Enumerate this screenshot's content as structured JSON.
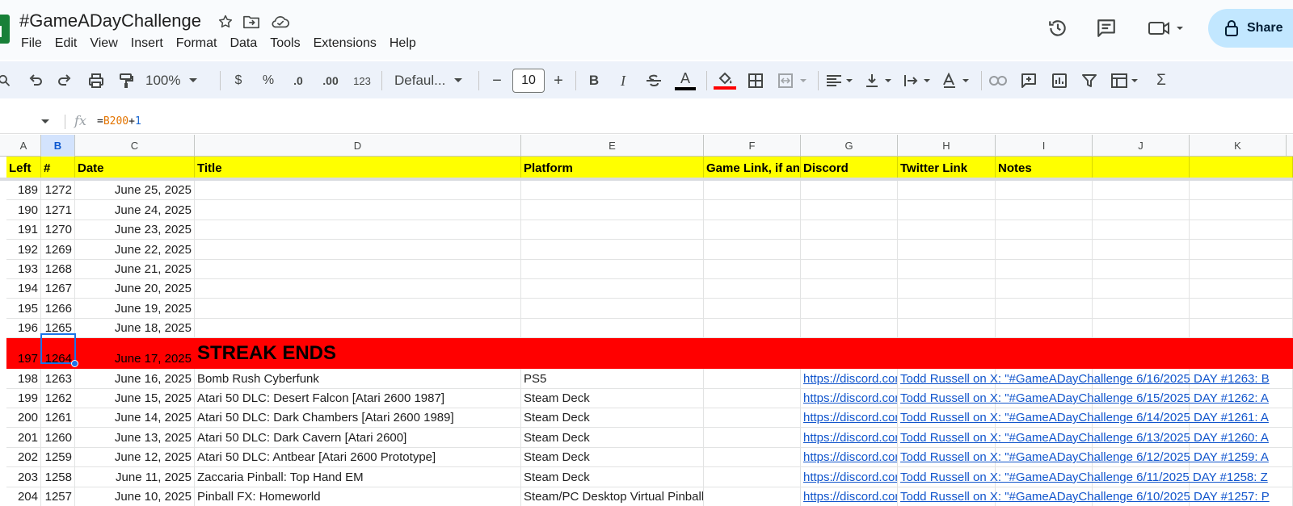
{
  "doc": {
    "title": "#GameADayChallenge",
    "star_icon": "star-icon",
    "move_icon": "folder-move-icon",
    "cloud_icon": "cloud-status-icon"
  },
  "menu": [
    "File",
    "Edit",
    "View",
    "Insert",
    "Format",
    "Data",
    "Tools",
    "Extensions",
    "Help"
  ],
  "top_right": {
    "history_icon": "history-icon",
    "comments_icon": "comment-icon",
    "meet_icon": "video-call-icon",
    "share_label": "Share"
  },
  "toolbar": {
    "zoom": "100%",
    "currency": "$",
    "percent": "%",
    "decrease_decimal": ".0",
    "increase_decimal": ".00",
    "more_formats": "123",
    "font": "Defaul...",
    "font_size": "10",
    "minus": "−",
    "plus": "+",
    "bold": "B",
    "italic": "I",
    "text_color_label": "A",
    "text_color": "#000000",
    "fill_color": "#ff0000",
    "sum": "Σ"
  },
  "formula_bar": {
    "name_box": "",
    "fx": "fx",
    "eq": "=",
    "ref": "B200",
    "op": "+",
    "num": "1"
  },
  "columns": [
    "A",
    "B",
    "C",
    "D",
    "E",
    "F",
    "G",
    "H",
    "I",
    "J",
    "K"
  ],
  "selected_column": "B",
  "header": {
    "left": "Left",
    "num": "#",
    "date": "Date",
    "title": "Title",
    "platform": "Platform",
    "game_link": "Game Link, if any",
    "discord": "Discord",
    "twitter": "Twitter Link",
    "notes": "Notes"
  },
  "rows": [
    {
      "left": "189",
      "num": "1272",
      "date": "June 25, 2025",
      "title": "",
      "platform": "",
      "discord": "",
      "twitter": ""
    },
    {
      "left": "190",
      "num": "1271",
      "date": "June 24, 2025",
      "title": "",
      "platform": "",
      "discord": "",
      "twitter": ""
    },
    {
      "left": "191",
      "num": "1270",
      "date": "June 23, 2025",
      "title": "",
      "platform": "",
      "discord": "",
      "twitter": ""
    },
    {
      "left": "192",
      "num": "1269",
      "date": "June 22, 2025",
      "title": "",
      "platform": "",
      "discord": "",
      "twitter": ""
    },
    {
      "left": "193",
      "num": "1268",
      "date": "June 21, 2025",
      "title": "",
      "platform": "",
      "discord": "",
      "twitter": ""
    },
    {
      "left": "194",
      "num": "1267",
      "date": "June 20, 2025",
      "title": "",
      "platform": "",
      "discord": "",
      "twitter": ""
    },
    {
      "left": "195",
      "num": "1266",
      "date": "June 19, 2025",
      "title": "",
      "platform": "",
      "discord": "",
      "twitter": ""
    },
    {
      "left": "196",
      "num": "1265",
      "date": "June 18, 2025",
      "title": "",
      "platform": "",
      "discord": "",
      "twitter": ""
    }
  ],
  "streak_row": {
    "left": "197",
    "num": "1264",
    "date": "June 17, 2025",
    "title": "STREAK ENDS"
  },
  "rows_after": [
    {
      "left": "198",
      "num": "1263",
      "date": "June 16, 2025",
      "title": "Bomb Rush Cyberfunk",
      "platform": "PS5",
      "discord": "https://discord.com",
      "twitter": "Todd Russell on X: \"#GameADayChallenge 6/16/2025 DAY #1263: B"
    },
    {
      "left": "199",
      "num": "1262",
      "date": "June 15, 2025",
      "title": "Atari 50 DLC: Desert Falcon [Atari 2600 1987]",
      "platform": "Steam Deck",
      "discord": "https://discord.com",
      "twitter": "Todd Russell on X: \"#GameADayChallenge 6/15/2025 DAY #1262: A"
    },
    {
      "left": "200",
      "num": "1261",
      "date": "June 14, 2025",
      "title": "Atari 50 DLC: Dark Chambers [Atari 2600 1989]",
      "platform": "Steam Deck",
      "discord": "https://discord.com",
      "twitter": "Todd Russell on X: \"#GameADayChallenge 6/14/2025 DAY #1261: A"
    },
    {
      "left": "201",
      "num": "1260",
      "date": "June 13, 2025",
      "title": "Atari 50 DLC: Dark Cavern [Atari 2600]",
      "platform": "Steam Deck",
      "discord": "https://discord.com",
      "twitter": "Todd Russell on X: \"#GameADayChallenge 6/13/2025 DAY #1260: A"
    },
    {
      "left": "202",
      "num": "1259",
      "date": "June 12, 2025",
      "title": "Atari 50 DLC: Antbear [Atari 2600 Prototype]",
      "platform": "Steam Deck",
      "discord": "https://discord.com",
      "twitter": "Todd Russell on X: \"#GameADayChallenge 6/12/2025 DAY #1259: A"
    },
    {
      "left": "203",
      "num": "1258",
      "date": "June 11, 2025",
      "title": "Zaccaria Pinball: Top Hand EM",
      "platform": "Steam Deck",
      "discord": "https://discord.com",
      "twitter": "Todd Russell on X: \"#GameADayChallenge 6/11/2025 DAY #1258: Z"
    },
    {
      "left": "204",
      "num": "1257",
      "date": "June 10, 2025",
      "title": "Pinball FX: Homeworld",
      "platform": "Steam/PC Desktop Virtual Pinball",
      "discord": "https://discord.com",
      "twitter": "Todd Russell on X: \"#GameADayChallenge 6/10/2025 DAY #1257: P"
    }
  ]
}
